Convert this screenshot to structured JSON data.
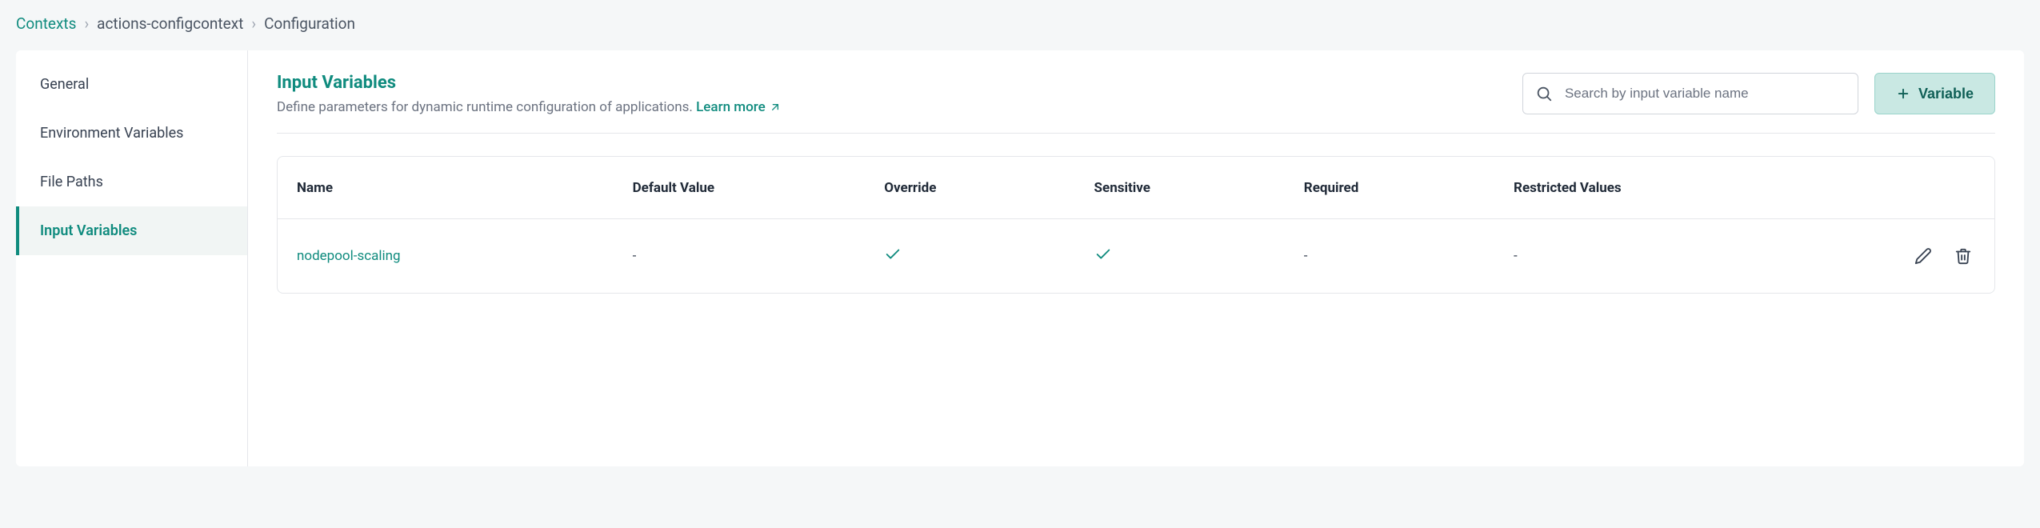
{
  "breadcrumb": {
    "root": "Contexts",
    "context_name": "actions-configcontext",
    "current": "Configuration"
  },
  "sidebar": {
    "items": [
      {
        "label": "General"
      },
      {
        "label": "Environment Variables"
      },
      {
        "label": "File Paths"
      },
      {
        "label": "Input Variables"
      }
    ]
  },
  "header": {
    "title": "Input Variables",
    "subtitle": "Define parameters for dynamic runtime configuration of applications.",
    "learn_more": "Learn more"
  },
  "search": {
    "placeholder": "Search by input variable name"
  },
  "add_button": {
    "label": "Variable"
  },
  "table": {
    "columns": {
      "name": "Name",
      "default_value": "Default Value",
      "override": "Override",
      "sensitive": "Sensitive",
      "required": "Required",
      "restricted_values": "Restricted Values"
    },
    "rows": [
      {
        "name": "nodepool-scaling",
        "default_value": "-",
        "override": true,
        "sensitive": true,
        "required": "-",
        "restricted_values": "-"
      }
    ]
  }
}
